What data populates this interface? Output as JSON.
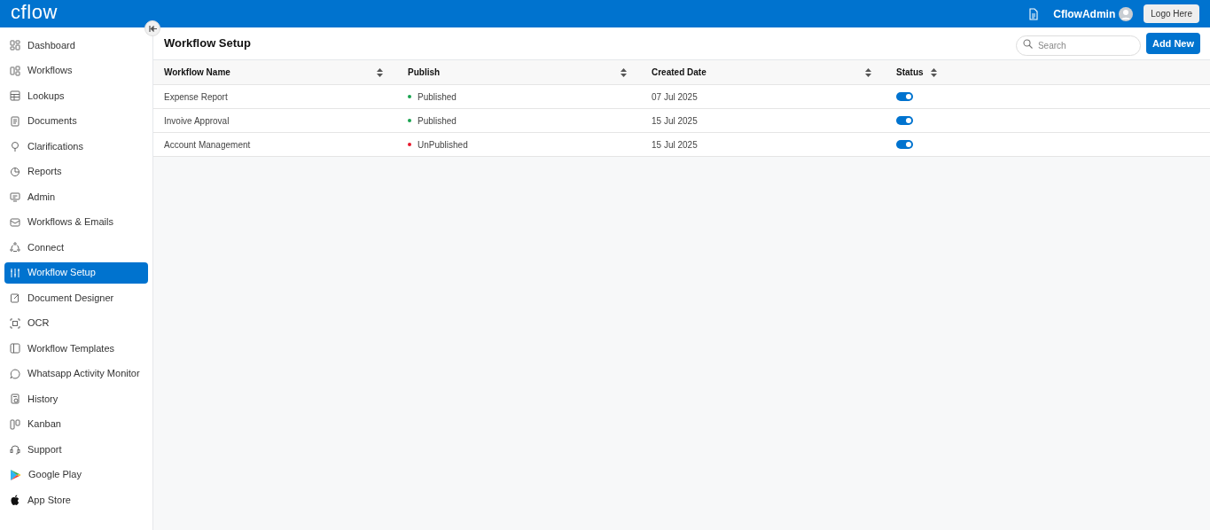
{
  "header": {
    "logo": "cflow",
    "user": "CflowAdmin",
    "logo_button": "Logo Here"
  },
  "sidebar": {
    "items": [
      {
        "label": "Dashboard",
        "selected": false
      },
      {
        "label": "Workflows",
        "selected": false
      },
      {
        "label": "Lookups",
        "selected": false
      },
      {
        "label": "Documents",
        "selected": false
      },
      {
        "label": "Clarifications",
        "selected": false
      },
      {
        "label": "Reports",
        "selected": false
      },
      {
        "label": "Admin",
        "selected": false
      },
      {
        "label": "Workflows & Emails",
        "selected": false
      },
      {
        "label": "Connect",
        "selected": false
      },
      {
        "label": "Workflow Setup",
        "selected": true
      },
      {
        "label": "Document Designer",
        "selected": false
      },
      {
        "label": "OCR",
        "selected": false
      },
      {
        "label": "Workflow Templates",
        "selected": false
      },
      {
        "label": "Whatsapp Activity Monitor",
        "selected": false
      },
      {
        "label": "History",
        "selected": false
      },
      {
        "label": "Kanban",
        "selected": false
      },
      {
        "label": "Support",
        "selected": false
      },
      {
        "label": "Google Play",
        "selected": false
      },
      {
        "label": "App Store",
        "selected": false
      }
    ]
  },
  "page": {
    "title": "Workflow Setup",
    "search": {
      "placeholder": "Search"
    },
    "add_button": "Add New"
  },
  "table": {
    "columns": [
      "Workflow Name",
      "Publish",
      "Created Date",
      "Status"
    ],
    "rows": [
      {
        "name": "Expense Report",
        "publish": "Published",
        "color": "#1aa350",
        "created": "07 Jul 2025",
        "on": true
      },
      {
        "name": "Invoive Approval",
        "publish": "Published",
        "color": "#1aa350",
        "created": "15 Jul 2025",
        "on": true
      },
      {
        "name": "Account Management",
        "publish": "UnPublished",
        "color": "#e8192c",
        "created": "15 Jul 2025",
        "on": true
      }
    ]
  }
}
